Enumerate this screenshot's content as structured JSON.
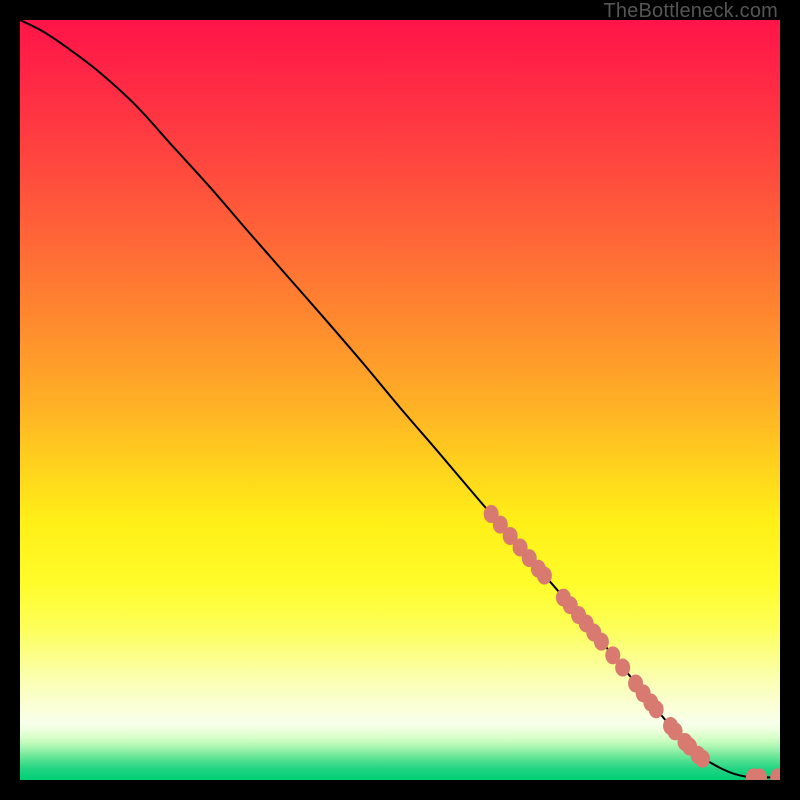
{
  "watermark": "TheBottleneck.com",
  "chart_data": {
    "type": "line",
    "title": "",
    "xlabel": "",
    "ylabel": "",
    "xlim": [
      0,
      100
    ],
    "ylim": [
      0,
      100
    ],
    "curve": {
      "x": [
        0,
        3,
        6,
        10,
        15,
        20,
        25,
        30,
        35,
        40,
        45,
        50,
        55,
        60,
        65,
        70,
        75,
        80,
        84,
        87,
        89,
        91,
        92.5,
        94,
        95.5,
        97,
        100
      ],
      "y": [
        100,
        98.5,
        96.5,
        93.5,
        89,
        83.5,
        78,
        72.2,
        66.5,
        60.8,
        55,
        49,
        43.2,
        37.3,
        31.5,
        25.8,
        20,
        14,
        9,
        5.5,
        3.5,
        2.2,
        1.4,
        0.8,
        0.45,
        0.35,
        0.35
      ]
    },
    "markers": [
      {
        "x": 62.0,
        "y": 35.0
      },
      {
        "x": 63.2,
        "y": 33.6
      },
      {
        "x": 64.5,
        "y": 32.1
      },
      {
        "x": 65.8,
        "y": 30.6
      },
      {
        "x": 67.0,
        "y": 29.2
      },
      {
        "x": 68.2,
        "y": 27.8
      },
      {
        "x": 69.0,
        "y": 26.9
      },
      {
        "x": 71.5,
        "y": 24.0
      },
      {
        "x": 72.4,
        "y": 23.0
      },
      {
        "x": 73.5,
        "y": 21.7
      },
      {
        "x": 74.5,
        "y": 20.6
      },
      {
        "x": 75.5,
        "y": 19.4
      },
      {
        "x": 76.5,
        "y": 18.2
      },
      {
        "x": 78.0,
        "y": 16.4
      },
      {
        "x": 79.3,
        "y": 14.8
      },
      {
        "x": 81.0,
        "y": 12.7
      },
      {
        "x": 82.0,
        "y": 11.4
      },
      {
        "x": 83.0,
        "y": 10.2
      },
      {
        "x": 83.7,
        "y": 9.3
      },
      {
        "x": 85.6,
        "y": 7.1
      },
      {
        "x": 86.2,
        "y": 6.4
      },
      {
        "x": 87.5,
        "y": 5.0
      },
      {
        "x": 88.1,
        "y": 4.4
      },
      {
        "x": 89.2,
        "y": 3.3
      },
      {
        "x": 89.8,
        "y": 2.8
      },
      {
        "x": 96.5,
        "y": 0.35
      },
      {
        "x": 97.3,
        "y": 0.35
      },
      {
        "x": 99.7,
        "y": 0.35
      }
    ],
    "gradient_stops": [
      {
        "offset": 0.0,
        "color": "#ff1449"
      },
      {
        "offset": 0.1,
        "color": "#ff2e44"
      },
      {
        "offset": 0.2,
        "color": "#ff4a3e"
      },
      {
        "offset": 0.3,
        "color": "#ff6a36"
      },
      {
        "offset": 0.4,
        "color": "#ff8b2e"
      },
      {
        "offset": 0.5,
        "color": "#ffae26"
      },
      {
        "offset": 0.58,
        "color": "#ffcf1e"
      },
      {
        "offset": 0.66,
        "color": "#ffef17"
      },
      {
        "offset": 0.74,
        "color": "#fffc2a"
      },
      {
        "offset": 0.8,
        "color": "#fdff58"
      },
      {
        "offset": 0.86,
        "color": "#fbffa8"
      },
      {
        "offset": 0.905,
        "color": "#faffd8"
      },
      {
        "offset": 0.925,
        "color": "#f8ffea"
      },
      {
        "offset": 0.935,
        "color": "#ecffdc"
      },
      {
        "offset": 0.945,
        "color": "#d5ffc7"
      },
      {
        "offset": 0.955,
        "color": "#b0f7b4"
      },
      {
        "offset": 0.965,
        "color": "#7eeba0"
      },
      {
        "offset": 0.975,
        "color": "#4de090"
      },
      {
        "offset": 0.985,
        "color": "#22d582"
      },
      {
        "offset": 1.0,
        "color": "#00ce76"
      }
    ],
    "marker_color": "#d97a70",
    "line_color": "#000000"
  }
}
